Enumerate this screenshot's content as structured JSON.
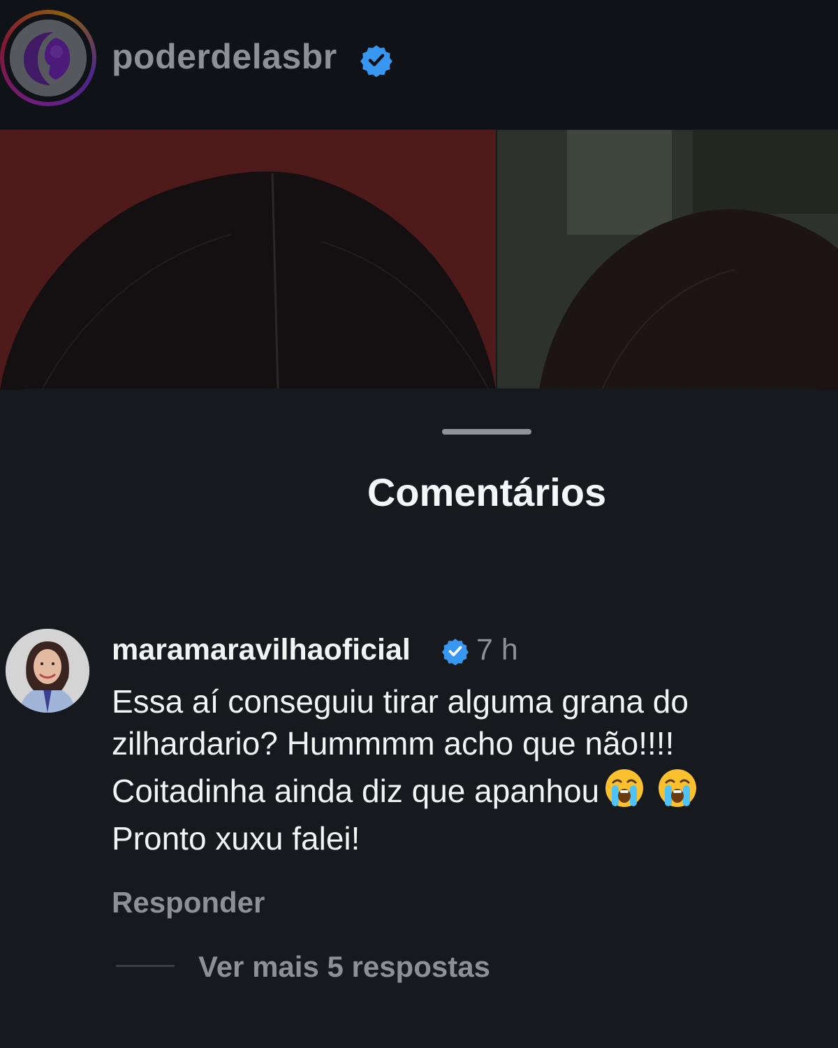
{
  "header": {
    "username": "poderdelasbr",
    "verified": true
  },
  "sheet": {
    "title": "Comentários"
  },
  "comment": {
    "username": "maramaravilhaoficial",
    "verified": true,
    "time": "7 h",
    "lines": [
      "Essa aí conseguiu tirar alguma grana do",
      "zilhardario? Hummmm acho que não!!!!",
      "Coitadinha ainda diz que apanhou",
      "Pronto xuxu falei!"
    ],
    "line3_emojis": [
      "loudly-crying-face",
      "loudly-crying-face"
    ],
    "reply_label": "Responder",
    "more_replies_label": "Ver mais 5 respostas"
  },
  "colors": {
    "verified_blue": "#3897f0",
    "sheet_background": "#16191e",
    "muted_text": "#8d9096"
  }
}
